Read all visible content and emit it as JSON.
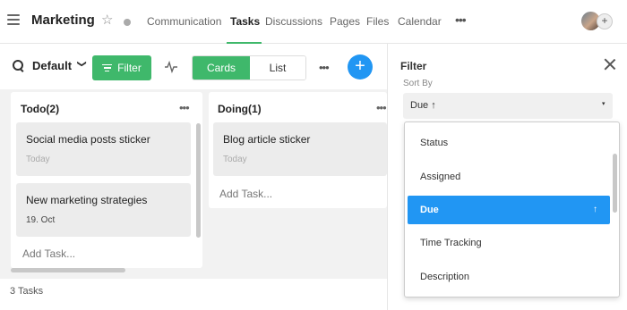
{
  "header": {
    "project_title": "Marketing",
    "star_glyph": "☆",
    "more_glyph": "•••",
    "add_member_glyph": "+",
    "tabs": [
      {
        "label": "Communication"
      },
      {
        "label": "Tasks",
        "active": true
      },
      {
        "label": "Discussions"
      },
      {
        "label": "Pages"
      },
      {
        "label": "Files"
      },
      {
        "label": "Calendar"
      }
    ]
  },
  "toolbar": {
    "view_name": "Default",
    "view_chevron": "❯",
    "filter_label": "Filter",
    "view_modes": [
      "Cards",
      "List"
    ],
    "active_view_mode": "Cards",
    "more_glyph": "•••",
    "add_glyph": "+"
  },
  "board": {
    "columns": [
      {
        "title": "Todo(2)",
        "menu_glyph": "•••",
        "cards": [
          {
            "title": "Social media posts sticker",
            "due": "Today"
          },
          {
            "title": "New marketing strategies",
            "due": "19. Oct"
          }
        ],
        "add_task_label": "Add Task..."
      },
      {
        "title": "Doing(1)",
        "menu_glyph": "•••",
        "cards": [
          {
            "title": "Blog article sticker",
            "due": "Today"
          }
        ],
        "add_task_label": "Add Task..."
      }
    ],
    "task_count": "3 Tasks"
  },
  "filter_panel": {
    "title": "Filter",
    "sort_by_label": "Sort By",
    "sort_value": "Due ↑",
    "sort_chevron": "▾",
    "options": [
      {
        "label": "Status"
      },
      {
        "label": "Assigned"
      },
      {
        "label": "Due",
        "selected": true,
        "arrow": "↑"
      },
      {
        "label": "Time Tracking"
      },
      {
        "label": "Description"
      }
    ]
  },
  "colors": {
    "accent_green": "#3fb86b",
    "accent_blue": "#2196f3"
  }
}
